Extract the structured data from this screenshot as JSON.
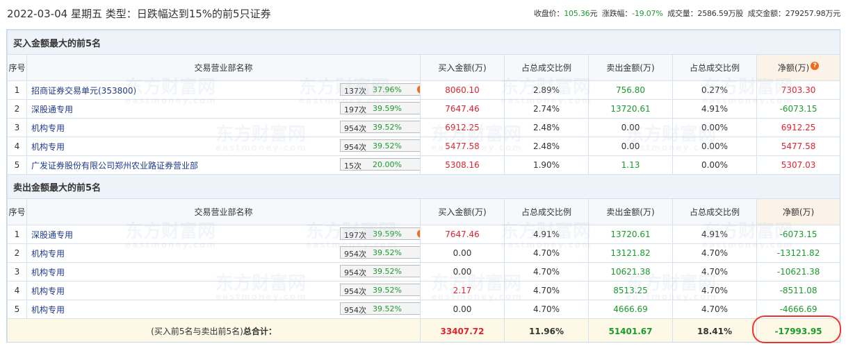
{
  "header": {
    "title": "2022-03-04 星期五 类型：日跌幅达到15%的前5只证券",
    "close_label": "收盘价：",
    "close_value": "105.36",
    "close_unit": "元",
    "chg_label": "涨跌幅：",
    "chg_value": "-19.07%",
    "vol_label": "成交量：",
    "vol_value": "2586.59万股",
    "amt_label": "成交金额：",
    "amt_value": "279257.98万元"
  },
  "columns": {
    "idx": "序号",
    "name": "交易营业部名称",
    "buy": "买入金额(万)",
    "buy_ratio": "占总成交比例",
    "sell": "卖出金额(万)",
    "sell_ratio": "占总成交比例",
    "net": "净额(万)"
  },
  "watermark": {
    "cn": "东方财富网",
    "en": "eastmoney.com"
  },
  "buy_section": {
    "title": "买入金额最大的前5名",
    "rows": [
      {
        "idx": "1",
        "name": "招商证券交易单元(353800)",
        "count": "137次",
        "pct": "37.96%",
        "icon": "question-icon",
        "buy": "8060.10",
        "buy_ratio": "2.89%",
        "sell": "756.80",
        "sell_ratio": "0.27%",
        "net": "7303.30",
        "net_color": "#e0222e",
        "buy_color": "#e0222e",
        "sell_color": "#1a9b2c"
      },
      {
        "idx": "2",
        "name": "深股通专用",
        "count": "197次",
        "pct": "39.59%",
        "icon": "arrow-right-icon",
        "buy": "7647.46",
        "buy_ratio": "2.74%",
        "sell": "13720.61",
        "sell_ratio": "4.91%",
        "net": "-6073.15",
        "net_color": "#1a9b2c",
        "buy_color": "#e0222e",
        "sell_color": "#1a9b2c"
      },
      {
        "idx": "3",
        "name": "机构专用",
        "count": "954次",
        "pct": "39.52%",
        "icon": "arrow-right-icon",
        "buy": "6912.25",
        "buy_ratio": "2.48%",
        "sell": "0.00",
        "sell_ratio": "0.00%",
        "net": "6912.25",
        "net_color": "#e0222e",
        "buy_color": "#e0222e",
        "sell_color": "#333333"
      },
      {
        "idx": "4",
        "name": "机构专用",
        "count": "954次",
        "pct": "39.52%",
        "icon": "arrow-right-icon",
        "buy": "5477.58",
        "buy_ratio": "2.48%",
        "sell": "0.00",
        "sell_ratio": "0.00%",
        "net": "5477.58",
        "net_color": "#e0222e",
        "buy_color": "#e0222e",
        "sell_color": "#333333"
      },
      {
        "idx": "5",
        "name": "广发证券股份有限公司郑州农业路证券营业部",
        "count": "15次",
        "pct": "20.00%",
        "icon": "arrow-right-icon",
        "buy": "5308.16",
        "buy_ratio": "1.90%",
        "sell": "1.13",
        "sell_ratio": "0.00%",
        "net": "5307.03",
        "net_color": "#e0222e",
        "buy_color": "#e0222e",
        "sell_color": "#1a9b2c"
      }
    ]
  },
  "sell_section": {
    "title": "卖出金额最大的前5名",
    "rows": [
      {
        "idx": "1",
        "name": "深股通专用",
        "count": "197次",
        "pct": "39.59%",
        "icon": "question-icon",
        "buy": "7647.46",
        "buy_ratio": "4.91%",
        "sell": "13720.61",
        "sell_ratio": "4.91%",
        "net": "-6073.15",
        "net_color": "#1a9b2c",
        "buy_color": "#e0222e",
        "sell_color": "#1a9b2c"
      },
      {
        "idx": "2",
        "name": "机构专用",
        "count": "954次",
        "pct": "39.52%",
        "icon": "arrow-right-icon",
        "buy": "0.00",
        "buy_ratio": "4.70%",
        "sell": "13121.82",
        "sell_ratio": "4.70%",
        "net": "-13121.82",
        "net_color": "#1a9b2c",
        "buy_color": "#333333",
        "sell_color": "#1a9b2c"
      },
      {
        "idx": "3",
        "name": "机构专用",
        "count": "954次",
        "pct": "39.52%",
        "icon": "arrow-right-icon",
        "buy": "0.00",
        "buy_ratio": "4.70%",
        "sell": "10621.38",
        "sell_ratio": "4.70%",
        "net": "-10621.38",
        "net_color": "#1a9b2c",
        "buy_color": "#333333",
        "sell_color": "#1a9b2c"
      },
      {
        "idx": "4",
        "name": "机构专用",
        "count": "954次",
        "pct": "39.52%",
        "icon": "arrow-right-icon",
        "buy": "2.17",
        "buy_ratio": "4.70%",
        "sell": "8513.25",
        "sell_ratio": "4.70%",
        "net": "-8511.08",
        "net_color": "#1a9b2c",
        "buy_color": "#e0222e",
        "sell_color": "#1a9b2c"
      },
      {
        "idx": "5",
        "name": "机构专用",
        "count": "954次",
        "pct": "39.52%",
        "icon": "arrow-right-icon",
        "buy": "0.00",
        "buy_ratio": "4.70%",
        "sell": "4666.69",
        "sell_ratio": "4.70%",
        "net": "-4666.69",
        "net_color": "#1a9b2c",
        "buy_color": "#333333",
        "sell_color": "#1a9b2c"
      }
    ]
  },
  "total": {
    "label_pre": "(买入前5名与卖出前5名)",
    "label_bold": "总合计：",
    "buy": "33407.72",
    "buy_ratio": "11.96%",
    "sell": "51401.67",
    "sell_ratio": "18.41%",
    "net": "-17993.95"
  },
  "colors": {
    "red": "#e0222e",
    "green": "#1a9b2c",
    "highlight_circle": "#ee3333"
  }
}
